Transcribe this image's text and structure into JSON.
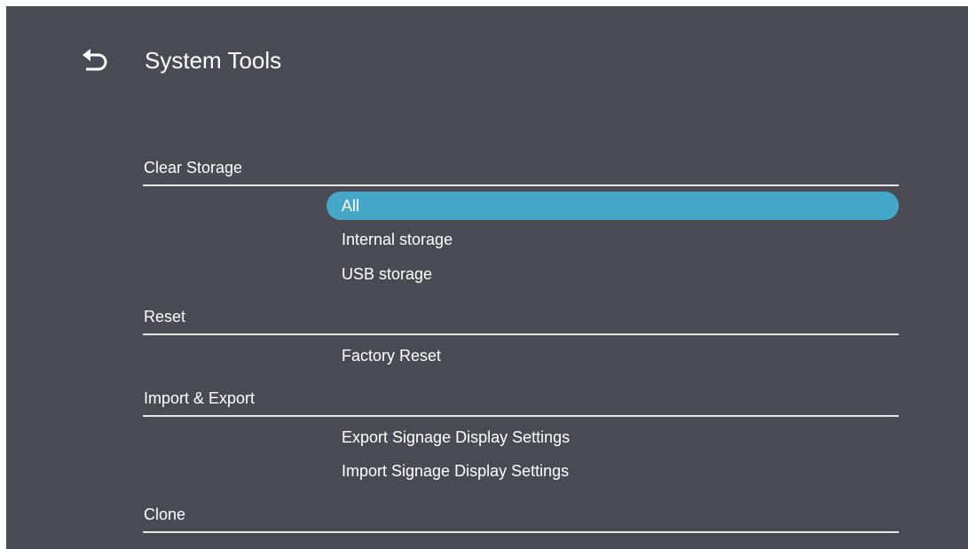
{
  "header": {
    "title": "System Tools",
    "back_icon": "back-arrow-icon"
  },
  "colors": {
    "background": "#4a4a54",
    "accent": "#45a8c8",
    "divider": "#e6e6e6",
    "text": "#ffffff"
  },
  "sections": [
    {
      "label": "Clear Storage",
      "options": [
        {
          "label": "All",
          "selected": true
        },
        {
          "label": "Internal storage",
          "selected": false
        },
        {
          "label": "USB storage",
          "selected": false
        }
      ]
    },
    {
      "label": "Reset",
      "options": [
        {
          "label": "Factory Reset",
          "selected": false
        }
      ]
    },
    {
      "label": "Import & Export",
      "options": [
        {
          "label": "Export Signage Display Settings",
          "selected": false
        },
        {
          "label": "Import Signage Display Settings",
          "selected": false
        }
      ]
    },
    {
      "label": "Clone",
      "options": []
    }
  ]
}
